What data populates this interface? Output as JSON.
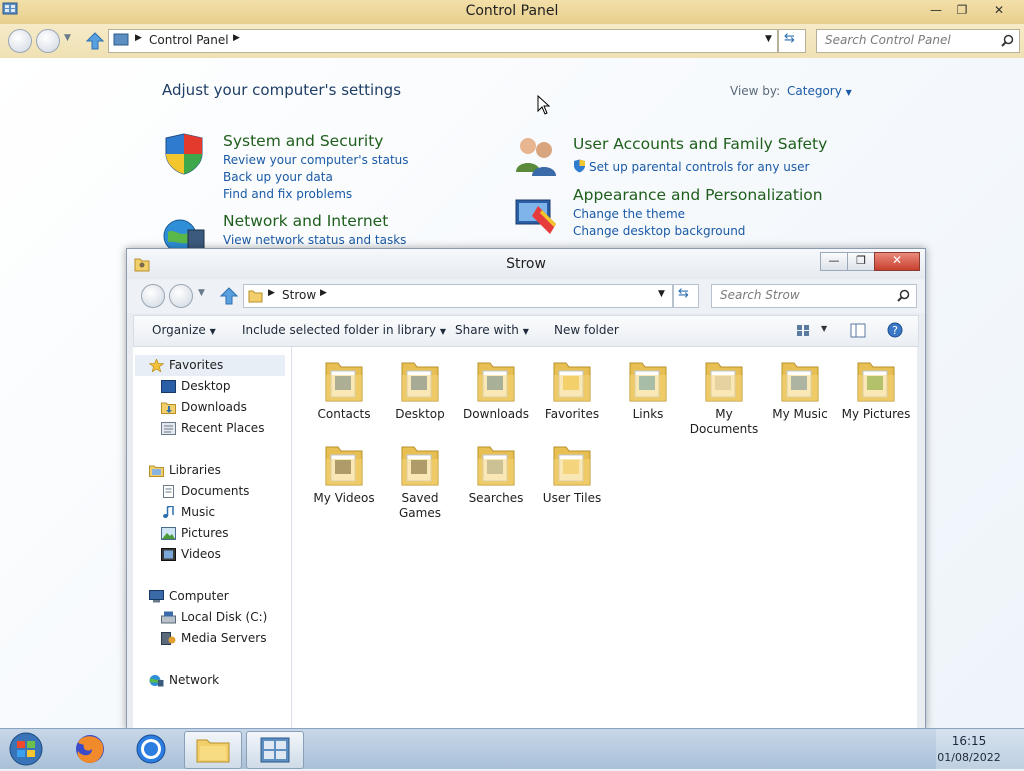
{
  "control_panel": {
    "title": "Control Panel",
    "breadcrumb": "Control Panel",
    "search_placeholder": "Search Control Panel",
    "heading": "Adjust your computer's settings",
    "view_by_label": "View by:",
    "view_by_value": "Category",
    "categories": [
      {
        "title": "System and Security",
        "links": [
          "Review your computer's status",
          "Back up your data",
          "Find and fix problems"
        ]
      },
      {
        "title": "Network and Internet",
        "links": [
          "View network status and tasks"
        ]
      },
      {
        "title": "User Accounts and Family Safety",
        "links": [
          "Set up parental controls for any user"
        ]
      },
      {
        "title": "Appearance and Personalization",
        "links": [
          "Change the theme",
          "Change desktop background"
        ]
      }
    ]
  },
  "explorer": {
    "title": "Strow",
    "breadcrumb": "Strow",
    "search_placeholder": "Search Strow",
    "toolbar": {
      "organize": "Organize",
      "include": "Include selected folder in library",
      "share": "Share with",
      "new_folder": "New folder"
    },
    "sidebar": {
      "favorites": "Favorites",
      "favorites_items": [
        "Desktop",
        "Downloads",
        "Recent Places"
      ],
      "libraries": "Libraries",
      "libraries_items": [
        "Documents",
        "Music",
        "Pictures",
        "Videos"
      ],
      "computer": "Computer",
      "computer_items": [
        "Local Disk (C:)",
        "Media Servers"
      ],
      "network": "Network"
    },
    "folders": [
      "Contacts",
      "Desktop",
      "Downloads",
      "Favorites",
      "Links",
      "My Documents",
      "My Music",
      "My Pictures",
      "My Videos",
      "Saved Games",
      "Searches",
      "User Tiles"
    ]
  },
  "taskbar": {
    "time": "16:15",
    "date": "01/08/2022"
  }
}
